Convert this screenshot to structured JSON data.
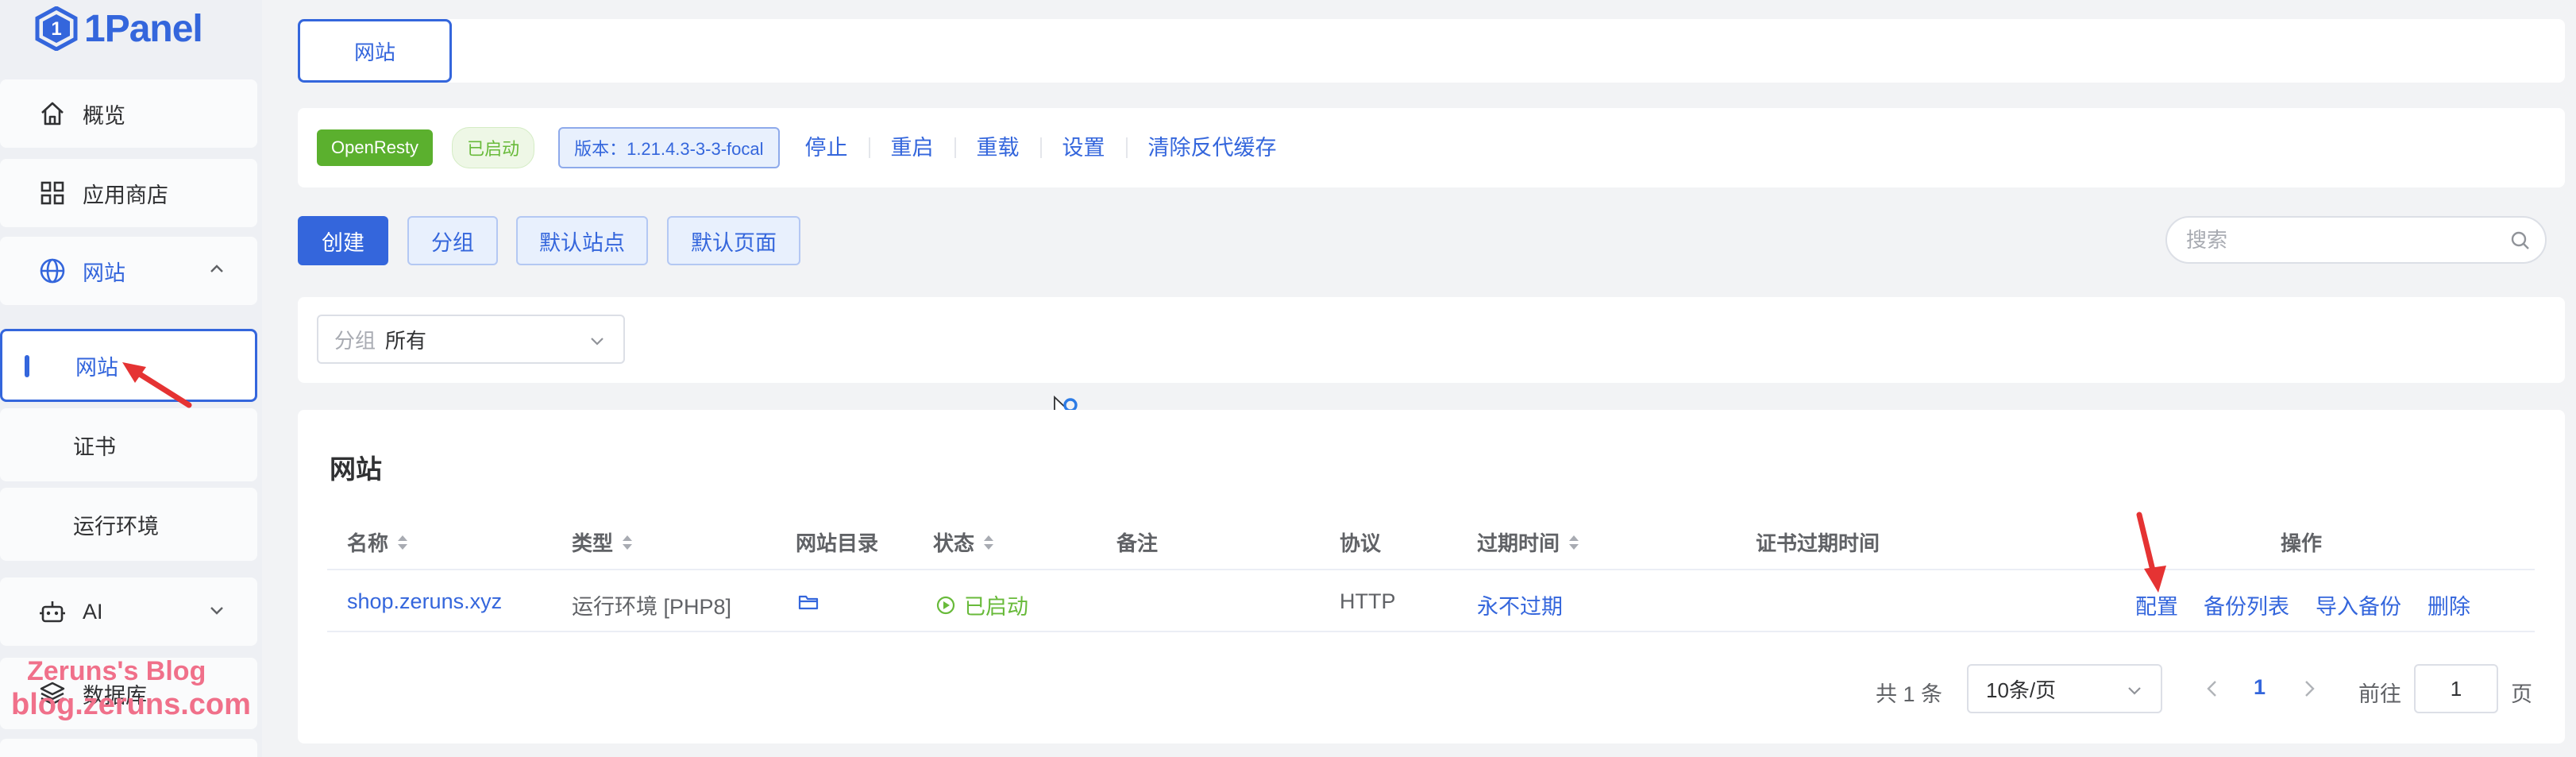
{
  "app": {
    "logo_text": "1Panel"
  },
  "sidebar": {
    "items": [
      {
        "label": "概览",
        "icon": "home-icon"
      },
      {
        "label": "应用商店",
        "icon": "apps-grid-icon"
      },
      {
        "label": "网站",
        "icon": "globe-icon",
        "expanded": true
      },
      {
        "label": "网站",
        "active": true
      },
      {
        "label": "证书"
      },
      {
        "label": "运行环境"
      },
      {
        "label": "AI",
        "icon": "robot-icon"
      },
      {
        "label": "数据库",
        "icon": "layers-icon"
      }
    ]
  },
  "watermark": {
    "line1": "Zeruns's Blog",
    "line2": "blog.zeruns.com"
  },
  "tabs": [
    {
      "label": "网站",
      "active": true
    }
  ],
  "status_bar": {
    "server": "OpenResty",
    "state": "已启动",
    "version": "版本：1.21.4.3-3-3-focal",
    "actions": [
      "停止",
      "重启",
      "重载",
      "设置",
      "清除反代缓存"
    ]
  },
  "toolbar": {
    "create": "创建",
    "group": "分组",
    "default_site": "默认站点",
    "default_page": "默认页面",
    "search_placeholder": "搜索"
  },
  "filter": {
    "label": "分组",
    "value": "所有"
  },
  "table": {
    "title": "网站",
    "columns": [
      "名称",
      "类型",
      "网站目录",
      "状态",
      "备注",
      "协议",
      "过期时间",
      "证书过期时间",
      "操作"
    ],
    "rows": [
      {
        "name": "shop.zeruns.xyz",
        "type": "运行环境 [PHP8]",
        "status": "已启动",
        "remark": "",
        "protocol": "HTTP",
        "expire": "永不过期",
        "cert_expire": "",
        "actions": [
          "配置",
          "备份列表",
          "导入备份",
          "删除"
        ]
      }
    ]
  },
  "pagination": {
    "total": "共 1 条",
    "page_size": "10条/页",
    "current": "1",
    "goto_label": "前往",
    "goto_value": "1",
    "page_suffix": "页"
  },
  "colors": {
    "accent": "#3466dc",
    "success": "#5bb02e",
    "annotation": "#e53333"
  }
}
